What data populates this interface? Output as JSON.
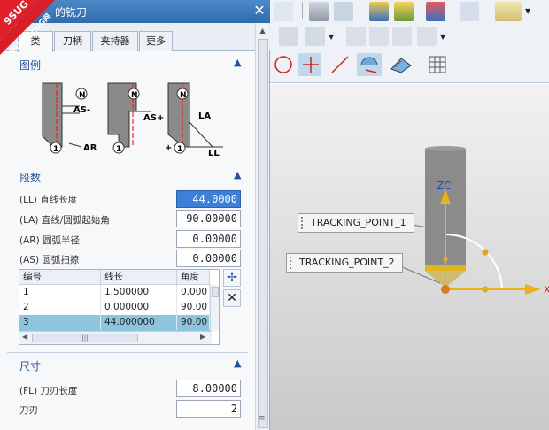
{
  "dialog": {
    "title": "的铣刀",
    "tabs": [
      "类",
      "刀柄",
      "夹持器",
      "更多"
    ]
  },
  "watermark": {
    "line1": "9SUG",
    "line2": "学UG就上UG网"
  },
  "legend_section": {
    "title": "图例",
    "labels": {
      "n": "N",
      "one": "1",
      "as_minus": "AS-",
      "as_plus": "AS+",
      "ar": "AR",
      "la": "LA",
      "ll": "LL",
      "plus": "+"
    }
  },
  "segments_section": {
    "title": "段数",
    "fields": [
      {
        "label": "(LL) 直线长度",
        "value": "44.0000"
      },
      {
        "label": "(LA) 直线/圆弧起始角",
        "value": "90.00000"
      },
      {
        "label": "(AR) 圆弧半径",
        "value": "0.00000"
      },
      {
        "label": "(AS) 圆弧扫掠",
        "value": "0.00000"
      }
    ],
    "table": {
      "headers": [
        "编号",
        "线长",
        "角度"
      ],
      "rows": [
        [
          "1",
          "1.500000",
          "0.000"
        ],
        [
          "2",
          "0.000000",
          "90.00"
        ],
        [
          "3",
          "44.000000",
          "90.00"
        ]
      ]
    }
  },
  "size_section": {
    "title": "尺寸",
    "fields": [
      {
        "label": "(FL) 刀刃长度",
        "value": "8.00000"
      },
      {
        "label": "刀刃",
        "value": "2"
      }
    ]
  },
  "viewport": {
    "axis_label": "ZC",
    "x_axis_label": "X",
    "tracking_points": [
      "TRACKING_POINT_1",
      "TRACKING_POINT_2"
    ]
  },
  "colors": {
    "title_bar": "#3a78bb",
    "section_title": "#27509b",
    "selected_input": "#3d7fd9",
    "selected_row": "#8dc4df",
    "axis_yellow": "#e8b21a"
  }
}
